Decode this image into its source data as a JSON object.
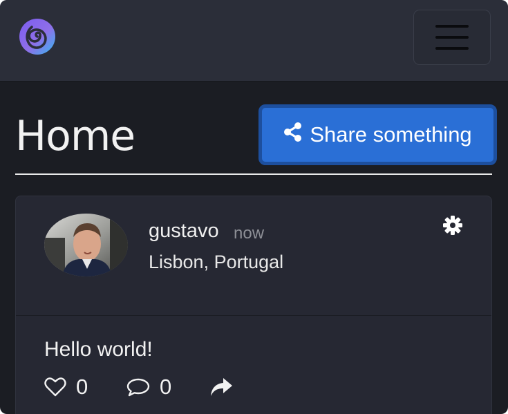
{
  "navbar": {
    "logo_icon": "spiral-logo",
    "menu_icon": "hamburger-menu-icon"
  },
  "header": {
    "title": "Home",
    "share_label": "Share something",
    "share_icon": "share-nodes-icon"
  },
  "post": {
    "author": "gustavo",
    "time": "now",
    "location": "Lisbon, Portugal",
    "text": "Hello world!",
    "likes": "0",
    "comments": "0",
    "settings_icon": "gear-icon",
    "like_icon": "heart-outline-icon",
    "comment_icon": "speech-bubble-icon",
    "share_icon": "share-arrow-icon"
  },
  "colors": {
    "background": "#1b1d23",
    "navbar": "#2b2e39",
    "card": "#262833",
    "accent": "#2a6fd6"
  }
}
